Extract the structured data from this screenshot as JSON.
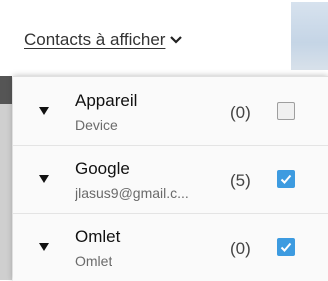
{
  "header": {
    "title": "Contacts à afficher",
    "chevron_icon": "chevron-down-icon"
  },
  "accounts": [
    {
      "name": "Appareil",
      "subtitle": "Device",
      "count": "(0)",
      "checked": false
    },
    {
      "name": "Google",
      "subtitle": "jlasus9@gmail.c...",
      "count": "(5)",
      "checked": true
    },
    {
      "name": "Omlet",
      "subtitle": "Omlet",
      "count": "(0)",
      "checked": true
    }
  ],
  "colors": {
    "accent": "#3d9be0",
    "text": "#111111",
    "subtext": "#6a6a6a"
  }
}
